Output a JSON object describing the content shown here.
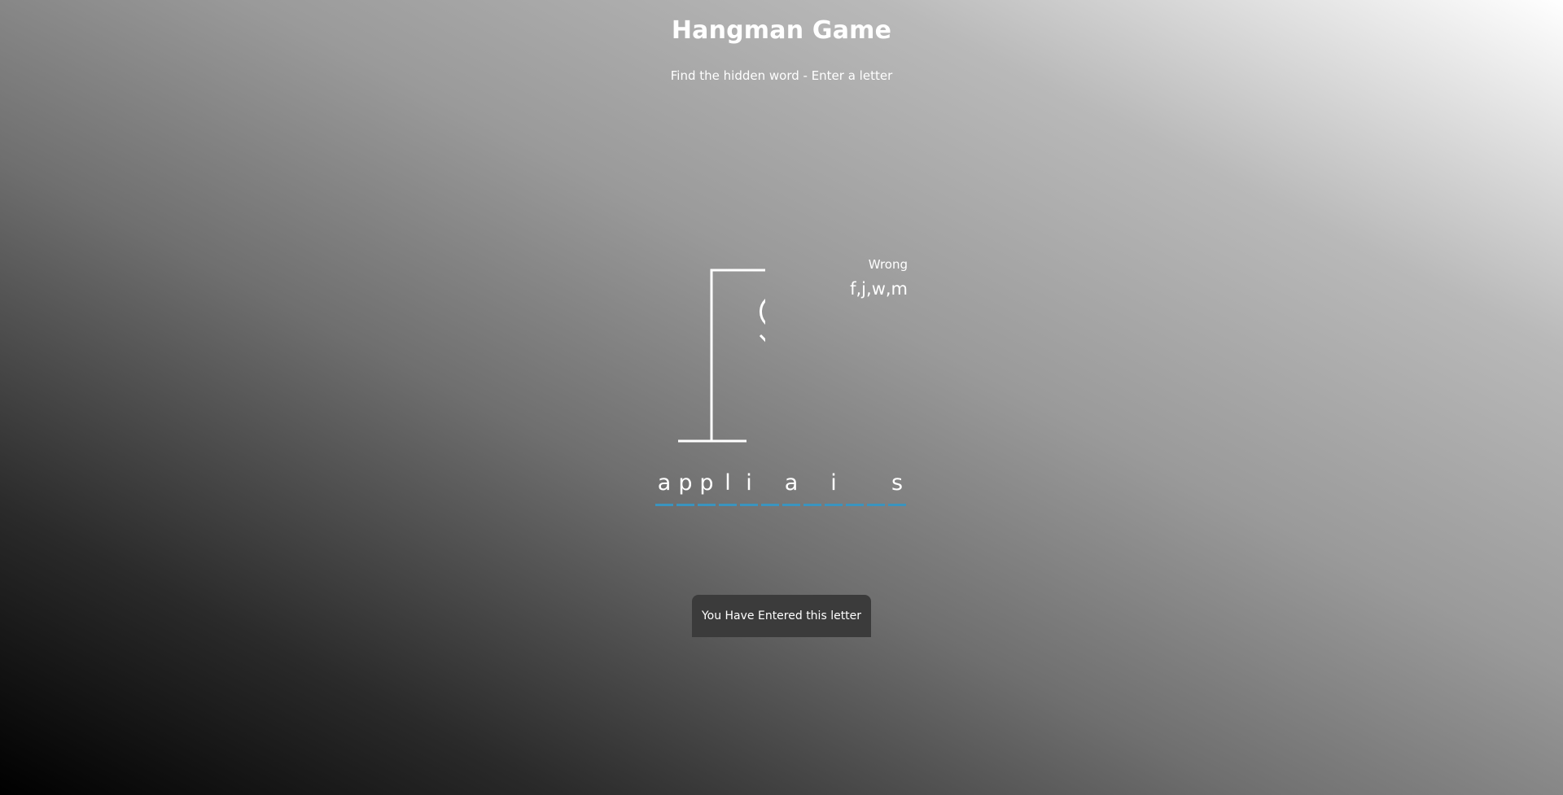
{
  "header": {
    "title": "Hangman Game",
    "subtitle": "Find the hidden word - Enter a letter"
  },
  "wrong": {
    "label": "Wrong",
    "letters": "f,j,w,m"
  },
  "word": {
    "letters": [
      "a",
      "p",
      "p",
      "l",
      "i",
      "",
      "a",
      "",
      "i",
      "",
      "",
      "s"
    ]
  },
  "notification": {
    "text": "You Have Entered this letter"
  },
  "colors": {
    "underline": "#3a94bf",
    "notification_bg": "#3b3b3b"
  }
}
